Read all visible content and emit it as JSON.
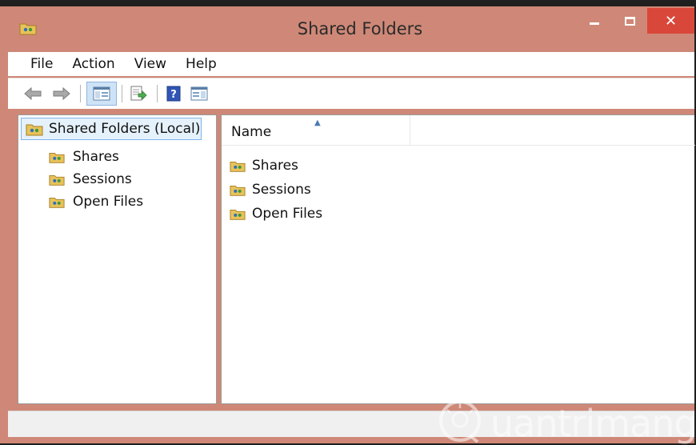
{
  "window": {
    "title": "Shared Folders",
    "close_glyph": "✕"
  },
  "menu": [
    "File",
    "Action",
    "View",
    "Help"
  ],
  "toolbar": {
    "buttons": [
      "back-arrow-icon",
      "forward-arrow-icon",
      "show-hide-tree-icon",
      "export-list-icon",
      "help-icon",
      "show-action-pane-icon"
    ]
  },
  "tree": {
    "root": "Shared Folders (Local)",
    "items": [
      "Shares",
      "Sessions",
      "Open Files"
    ]
  },
  "list": {
    "column_name": "Name",
    "sort_glyph": "▲",
    "items": [
      "Shares",
      "Sessions",
      "Open Files"
    ]
  },
  "watermark": {
    "text": "uantrimang"
  },
  "colors": {
    "titlebar": "#cf8877",
    "close": "#d9473a",
    "selection": "#e5f1fb",
    "selection_border": "#7eb4ea",
    "folder": "#e8c25a"
  }
}
